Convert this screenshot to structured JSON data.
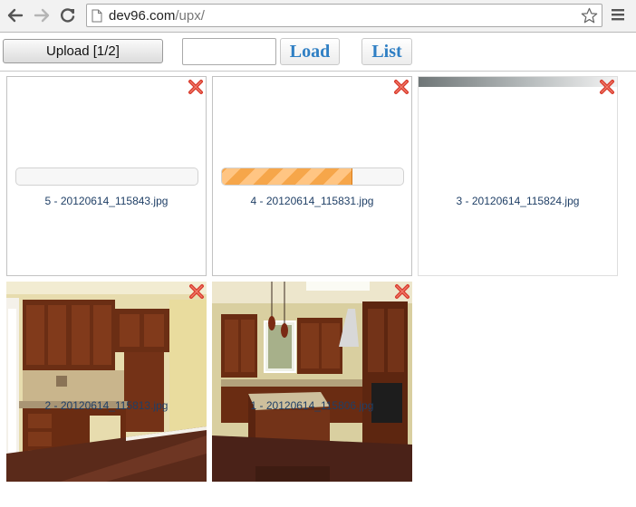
{
  "browser": {
    "url_host": "dev96.com",
    "url_path": "/upx/",
    "icons": {
      "back": "back-arrow-icon",
      "forward": "forward-arrow-icon",
      "reload": "reload-icon",
      "page": "page-icon",
      "bookmark": "star-icon",
      "menu": "hamburger-menu-icon"
    }
  },
  "toolbar": {
    "upload_label": "Upload [1/2]",
    "input_value": "",
    "load_label": "Load",
    "list_label": "List"
  },
  "tiles": [
    {
      "name": "5 - 20120614_115843.jpg",
      "progress": 0.0,
      "state": "uploading"
    },
    {
      "name": "4 - 20120614_115831.jpg",
      "progress": 0.72,
      "state": "uploading"
    },
    {
      "name": "3 - 20120614_115824.jpg",
      "state": "loading-image"
    },
    {
      "name": "2 - 20120614_115813.jpg",
      "state": "done",
      "image": "kitchen-cabinets-desk"
    },
    {
      "name": "1 - 20120614_115806.jpg",
      "state": "done",
      "image": "kitchen-island"
    }
  ],
  "colors": {
    "accent_link": "#2f7fc4",
    "progress_orange": "#f6a64a",
    "close_red": "#d83a2c",
    "filename_text": "#1f3f66"
  }
}
